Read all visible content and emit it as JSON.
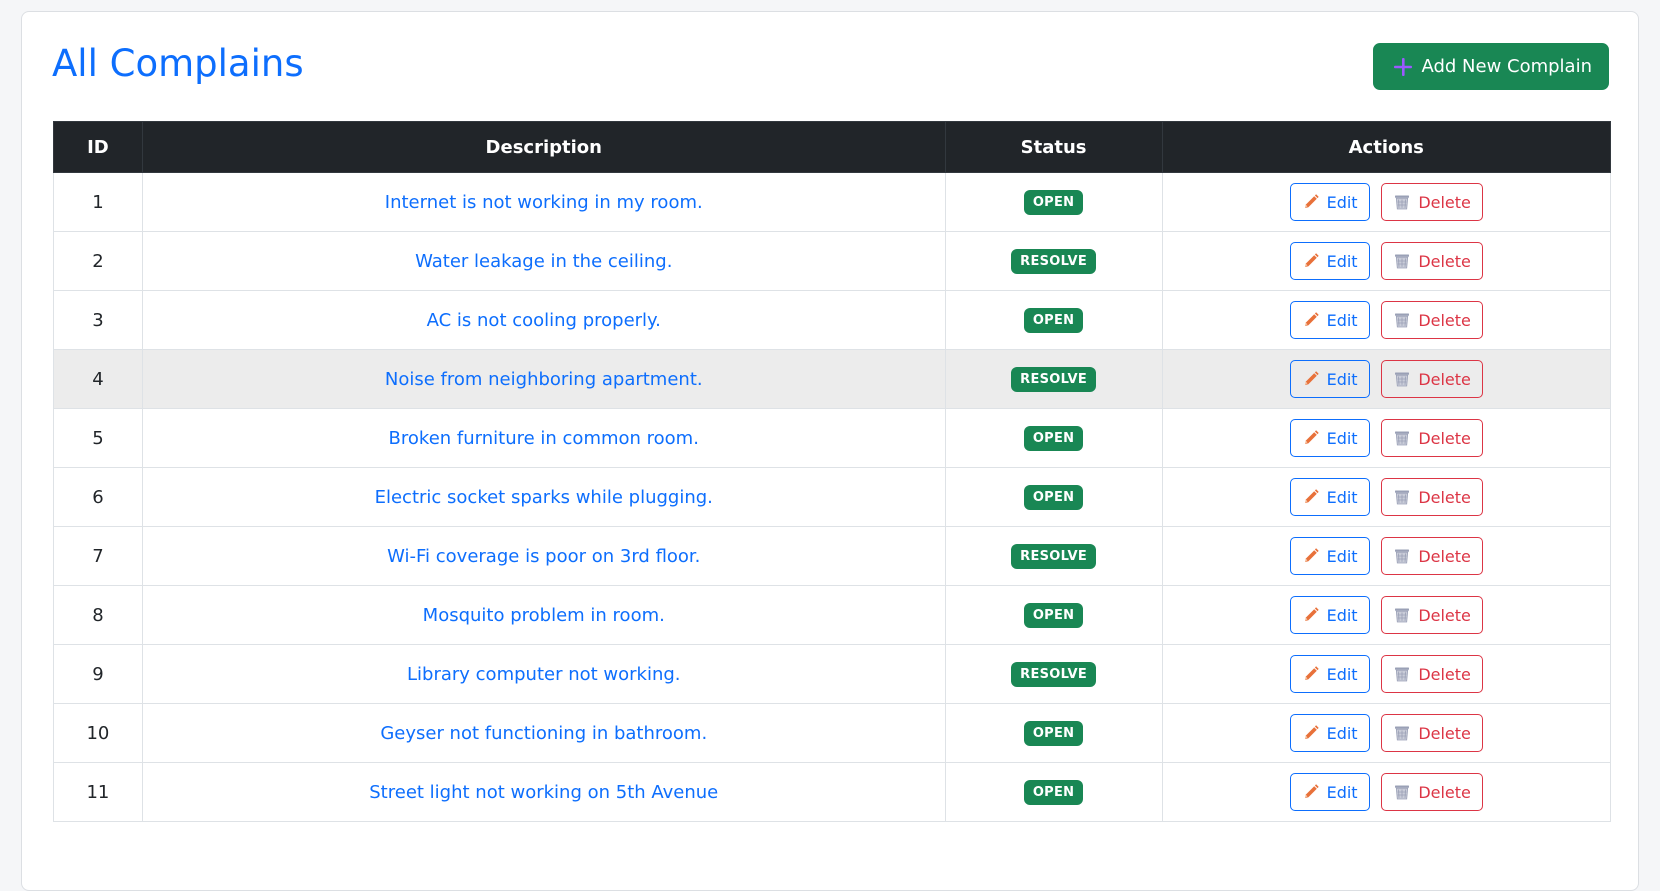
{
  "page": {
    "title": "All Complains",
    "add_button_label": "Add New Complain"
  },
  "table": {
    "headers": {
      "id": "ID",
      "description": "Description",
      "status": "Status",
      "actions": "Actions"
    },
    "edit_label": "Edit",
    "delete_label": "Delete",
    "rows": [
      {
        "id": "1",
        "description": "Internet is not working in my room.",
        "status": "OPEN"
      },
      {
        "id": "2",
        "description": "Water leakage in the ceiling.",
        "status": "RESOLVE"
      },
      {
        "id": "3",
        "description": "AC is not cooling properly.",
        "status": "OPEN"
      },
      {
        "id": "4",
        "description": "Noise from neighboring apartment.",
        "status": "RESOLVE"
      },
      {
        "id": "5",
        "description": "Broken furniture in common room.",
        "status": "OPEN"
      },
      {
        "id": "6",
        "description": "Electric socket sparks while plugging.",
        "status": "OPEN"
      },
      {
        "id": "7",
        "description": "Wi-Fi coverage is poor on 3rd floor.",
        "status": "RESOLVE"
      },
      {
        "id": "8",
        "description": "Mosquito problem in room.",
        "status": "OPEN"
      },
      {
        "id": "9",
        "description": "Library computer not working.",
        "status": "RESOLVE"
      },
      {
        "id": "10",
        "description": "Geyser not functioning in bathroom.",
        "status": "OPEN"
      },
      {
        "id": "11",
        "description": "Street light not working on 5th Avenue",
        "status": "OPEN"
      }
    ]
  },
  "icons": {
    "add": "plus-icon",
    "edit": "pencil-icon",
    "delete": "trash-icon"
  },
  "colors": {
    "primary": "#0d6efd",
    "success": "#198754",
    "danger": "#dc3545",
    "header_dark": "#212529",
    "pencil": "#e8713a"
  }
}
